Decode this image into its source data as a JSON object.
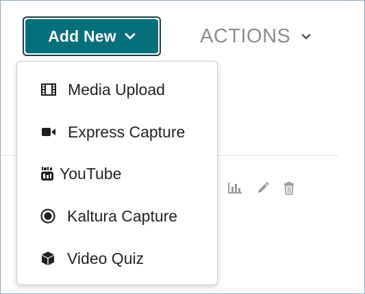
{
  "toolbar": {
    "add_new_label": "Add New",
    "actions_label": "ACTIONS"
  },
  "menu": {
    "items": [
      {
        "label": "Media Upload",
        "icon": "film-icon"
      },
      {
        "label": "Express Capture",
        "icon": "video-camera-icon"
      },
      {
        "label": "YouTube",
        "icon": "youtube-icon"
      },
      {
        "label": "Kaltura Capture",
        "icon": "record-icon"
      },
      {
        "label": "Video Quiz",
        "icon": "cube-icon"
      }
    ]
  },
  "row_actions": {
    "icons": [
      "analytics-icon",
      "edit-pencil-icon",
      "trash-icon"
    ]
  },
  "colors": {
    "primary": "#066f7c",
    "primary_border": "#1a3a44",
    "muted_text": "#8c8c8c",
    "row_icon": "#9a9a9a"
  }
}
